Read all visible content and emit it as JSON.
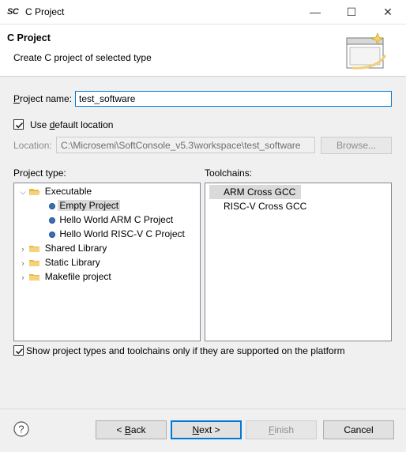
{
  "window": {
    "logo": "SC",
    "title": "C Project",
    "minimize": "—",
    "maximize": "☐",
    "close": "✕"
  },
  "header": {
    "title": "C Project",
    "description": "Create C project of selected type"
  },
  "form": {
    "project_name_label": "Project name:",
    "project_name_value": "test_software",
    "use_default_label": "Use default location",
    "use_default_checked": true,
    "location_label": "Location:",
    "location_value": "C:\\Microsemi\\SoftConsole_v5.3\\workspace\\test_software",
    "browse_label": "Browse..."
  },
  "project_type": {
    "label": "Project type:",
    "items": [
      {
        "label": "Executable",
        "expanded": true
      },
      {
        "label": "Empty Project",
        "selected": true
      },
      {
        "label": "Hello World ARM C Project"
      },
      {
        "label": "Hello World RISC-V C Project"
      },
      {
        "label": "Shared Library",
        "expanded": false
      },
      {
        "label": "Static Library",
        "expanded": false
      },
      {
        "label": "Makefile project",
        "expanded": false
      }
    ]
  },
  "toolchains": {
    "label": "Toolchains:",
    "items": [
      {
        "label": "ARM Cross GCC",
        "selected": true
      },
      {
        "label": "RISC-V Cross GCC"
      }
    ]
  },
  "platform_filter": {
    "label": "Show project types and toolchains only if they are supported on the platform",
    "checked": true
  },
  "buttons": {
    "back": "< Back",
    "next": "Next >",
    "finish": "Finish",
    "cancel": "Cancel"
  },
  "colors": {
    "accent": "#0078d7",
    "selection": "#dadada",
    "folder": "#e8b74a"
  }
}
